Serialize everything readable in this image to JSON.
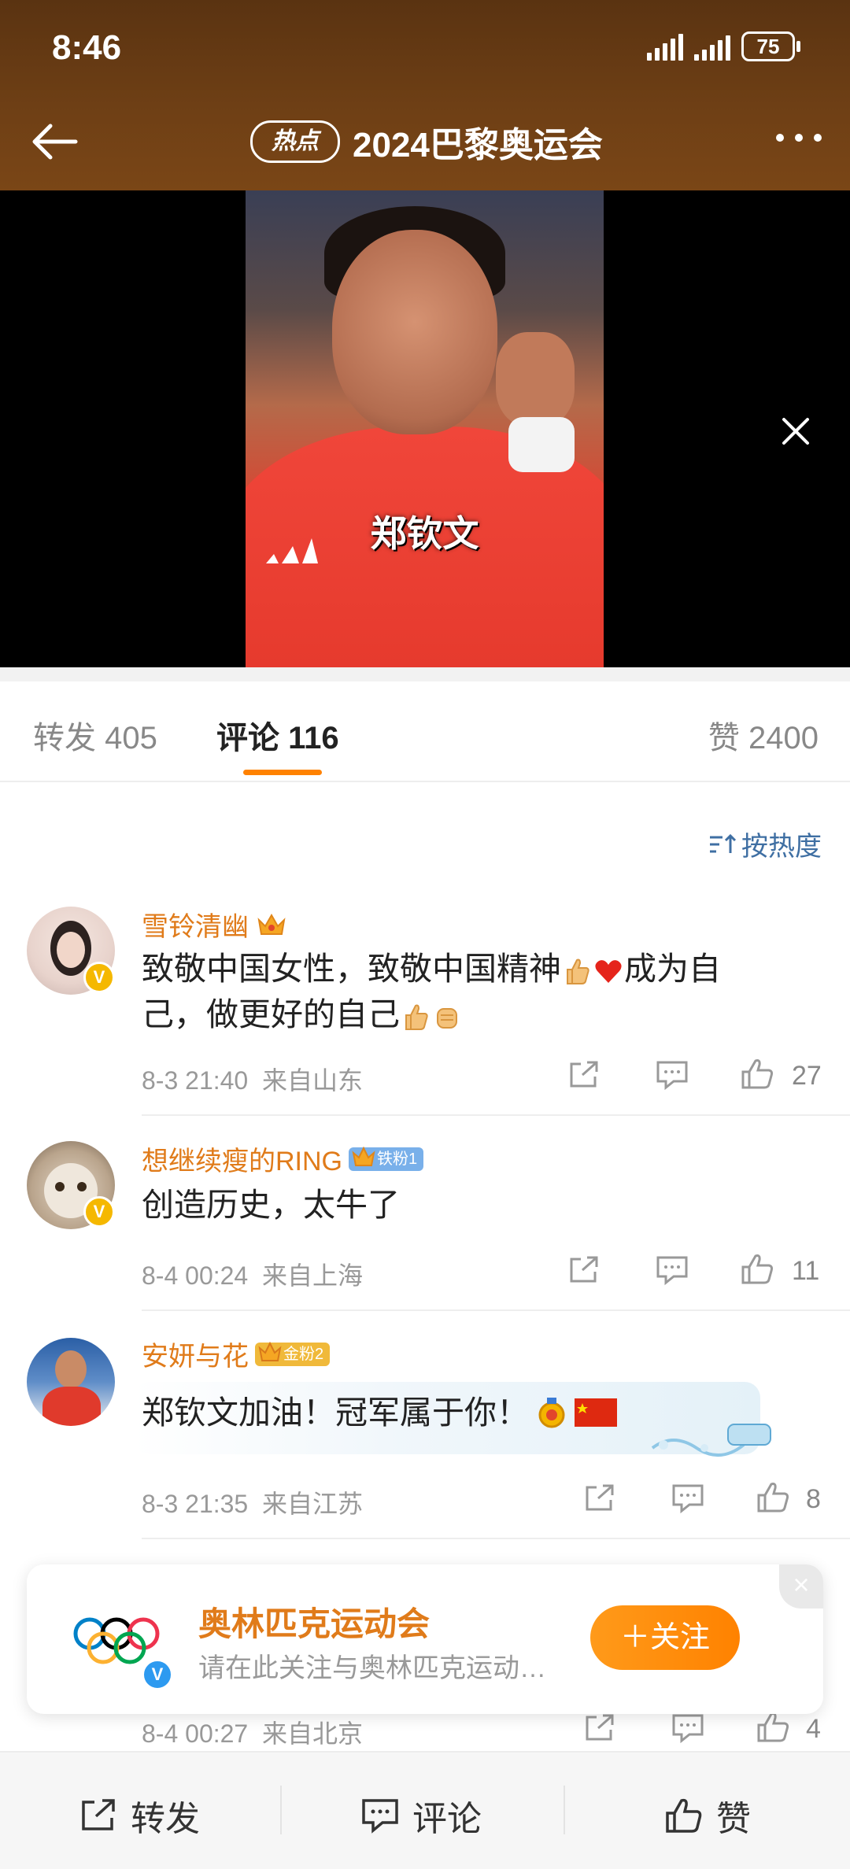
{
  "status_bar": {
    "time": "8:46",
    "battery": "75"
  },
  "header": {
    "badge": "热点",
    "title": "2024巴黎奥运会"
  },
  "video": {
    "caption": "郑钦文"
  },
  "tabs": {
    "repost": {
      "label": "转发",
      "count": "405"
    },
    "comment": {
      "label": "评论",
      "count": "116"
    },
    "like": {
      "label": "赞",
      "count": "2400"
    }
  },
  "sort": {
    "label": "按热度"
  },
  "comments": [
    {
      "user": "雪铃清幽",
      "text_a": "致敬中国女性，致敬中国精神",
      "text_b": "成为自",
      "text_c": "己，做更好的自己",
      "time": "8-3 21:40",
      "location": "来自山东",
      "likes": "27"
    },
    {
      "user": "想继续瘦的RING",
      "badge": "铁粉1",
      "text": "创造历史，太牛了",
      "time": "8-4 00:24",
      "location": "来自上海",
      "likes": "11"
    },
    {
      "user": "安妍与花",
      "badge": "金粉2",
      "text": "郑钦文加油！冠军属于你！",
      "time": "8-3 21:35",
      "location": "来自江苏",
      "likes": "8"
    },
    {
      "time": "8-4 00:27",
      "location": "来自北京",
      "likes": "4"
    }
  ],
  "promo": {
    "title": "奥林匹克运动会",
    "subtitle": "请在此关注与奥林匹克运动…",
    "follow": "＋关注"
  },
  "bottom_bar": {
    "repost": "转发",
    "comment": "评论",
    "like": "赞"
  },
  "colors": {
    "accent": "#ff8200",
    "username": "#e07b1a",
    "header_bg": "#6e3f15",
    "link": "#3f6fa3"
  }
}
